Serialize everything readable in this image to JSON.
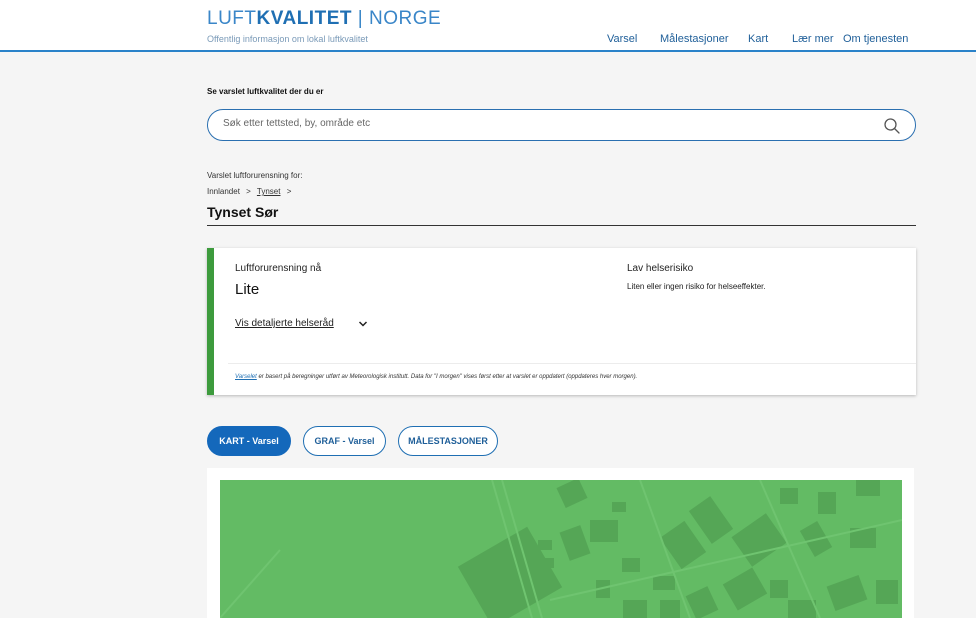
{
  "header": {
    "logo_part1": "LUFT",
    "logo_part2": "KVALITET",
    "logo_part3": " | NORGE",
    "tagline": "Offentlig informasjon om lokal luftkvalitet",
    "nav": [
      "Varsel",
      "Målestasjoner",
      "Kart",
      "Lær mer",
      "Om tjenesten"
    ]
  },
  "search": {
    "heading": "Se varslet luftkvalitet der du er",
    "placeholder": "Søk etter tettsted, by, område etc",
    "value": ""
  },
  "location": {
    "label": "Varslet luftforurensning for:",
    "breadcrumb": [
      "Innlandet",
      "Tynset"
    ],
    "separator": ">",
    "title": "Tynset Sør"
  },
  "status_card": {
    "pollution_label": "Luftforurensning nå",
    "pollution_value": "Lite",
    "risk_label": "Lav helserisiko",
    "risk_description": "Liten eller ingen risiko for helseeffekter.",
    "advice_link": "Vis detaljerte helseråd",
    "note_link": "Varselet",
    "note_text": " er basert på beregninger utført av Meteorologisk institutt. Data for \"I morgen\" vises først etter at varslet er oppdatert (oppdateres hver morgen).",
    "accent_color": "#3d9b3d"
  },
  "view_buttons": {
    "map": "KART - Varsel",
    "graph": "GRAF - Varsel",
    "stations": "MÅLESTASJONER",
    "active": "map"
  },
  "map": {
    "fill_color": "#63bb64"
  }
}
